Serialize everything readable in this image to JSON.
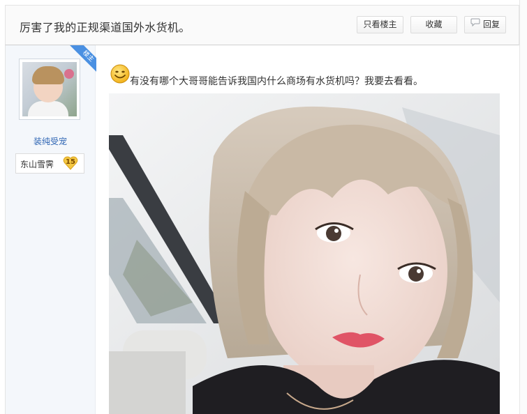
{
  "thread": {
    "title": "厉害了我的正规渠道国外水货机。",
    "buttons": {
      "only_op": "只看楼主",
      "favorite": "收藏",
      "reply": "回复"
    }
  },
  "post": {
    "op_badge": "楼主",
    "author": {
      "username": "装纯受宠",
      "forum_badge": {
        "name": "东山雪霁",
        "level": "15"
      }
    },
    "text": "有没有哪个大哥哥能告诉我国内什么商场有水货机吗？我要去看看。",
    "icons": {
      "emoticon": "smiley-face-icon",
      "reply": "speech-bubble-icon"
    },
    "colors": {
      "username": "#2d64b3",
      "op_ribbon": "#4a90e2",
      "level_badge": "#f5c842"
    }
  }
}
